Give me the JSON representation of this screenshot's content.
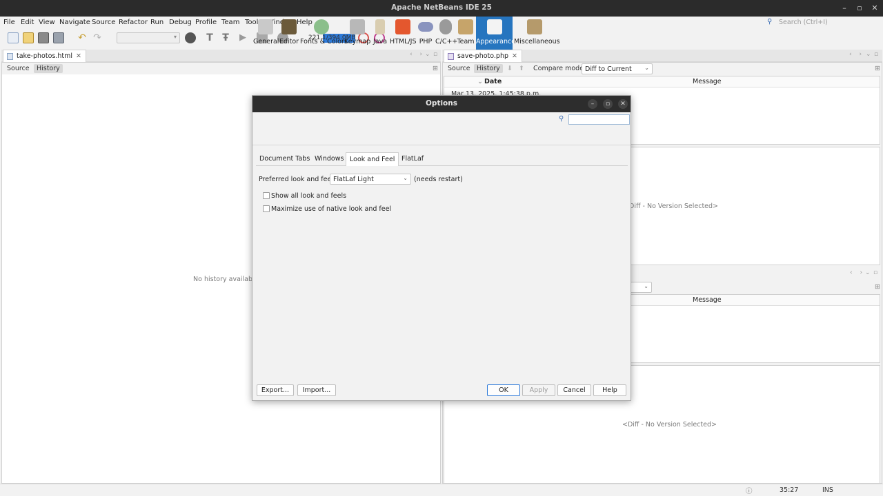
{
  "window": {
    "title": "Apache NetBeans IDE 25",
    "controls": [
      "minimize",
      "maximize",
      "close"
    ]
  },
  "menu": [
    "File",
    "Edit",
    "View",
    "Navigate",
    "Source",
    "Refactor",
    "Run",
    "Debug",
    "Profile",
    "Team",
    "Tools",
    "Window",
    "Help"
  ],
  "search": {
    "placeholder": "Search (Ctrl+I)"
  },
  "toolbar": {
    "memory": "221.1/394.0MB",
    "memory_used_fraction": 0.56,
    "icons": [
      "new-file-icon",
      "new-project-icon",
      "open-project-icon",
      "save-all-icon",
      "undo-icon",
      "redo-icon",
      "build-icon",
      "clean-build-icon",
      "run-icon",
      "debug-icon",
      "profile-icon",
      "gc-icon",
      "profiler-icon"
    ]
  },
  "left_editor": {
    "tab": "take-photos.html",
    "sub_tabs": {
      "source": "Source",
      "history": "History"
    },
    "message": "No history available."
  },
  "right_editor": {
    "tab": "save-photo.php",
    "sub_tabs": {
      "source": "Source",
      "history": "History"
    },
    "compare_label": "Compare mode:",
    "compare_value": "Diff to Current",
    "columns": {
      "date": "Date",
      "message": "Message"
    },
    "row_date": "Mar 13, 2025, 1:45:38 p.m.",
    "diff_message": "<Diff - No Version Selected>",
    "diff_message_partial": "Diff - No Version Selected>",
    "lower_message_col": "Message"
  },
  "dialog": {
    "title": "Options",
    "categories": [
      "General",
      "Editor",
      "Fonts & Colors",
      "Keymap",
      "Java",
      "HTML/JS",
      "PHP",
      "C/C++",
      "Team",
      "Appearance",
      "Miscellaneous"
    ],
    "selected_category": "Appearance",
    "tabs": [
      "Document Tabs",
      "Windows",
      "Look and Feel",
      "FlatLaf"
    ],
    "selected_tab": "Look and Feel",
    "pref_label": "Preferred look and feel:",
    "pref_value": "FlatLaf Light",
    "needs_restart": "(needs restart)",
    "checkboxes": [
      {
        "label": "Show all look and feels",
        "checked": false
      },
      {
        "label": "Maximize use of native look and feel",
        "checked": false
      }
    ],
    "buttons": {
      "export": "Export...",
      "import": "Import...",
      "ok": "OK",
      "apply": "Apply",
      "cancel": "Cancel",
      "help": "Help"
    }
  },
  "status": {
    "position": "35:27",
    "mode": "INS"
  }
}
